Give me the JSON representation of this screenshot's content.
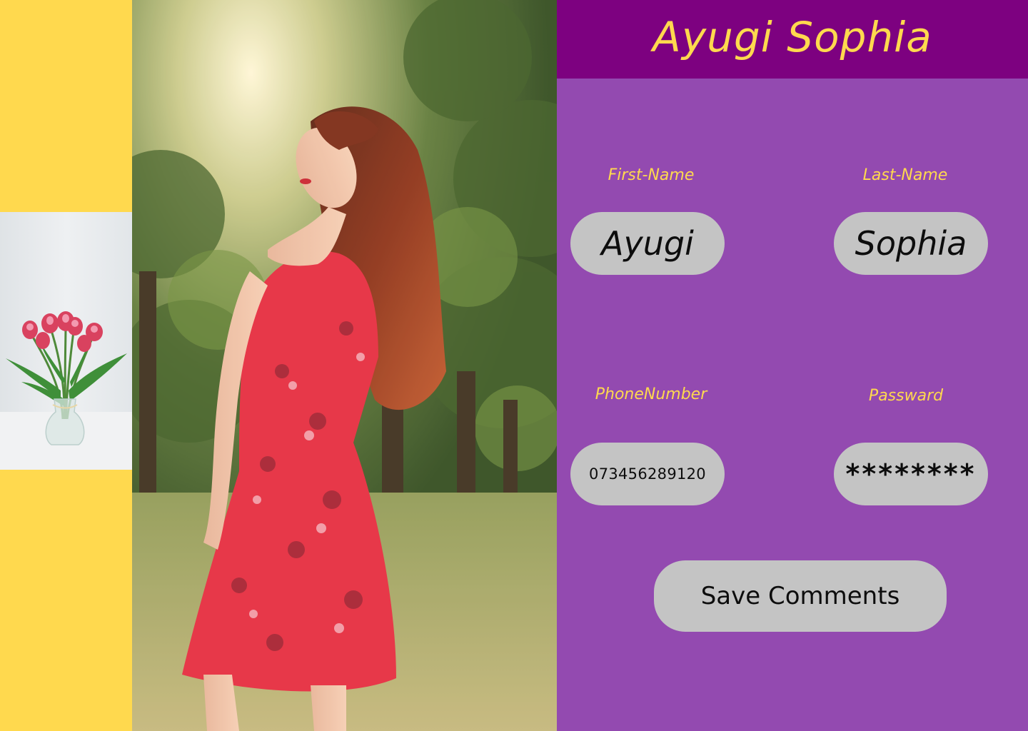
{
  "header": {
    "title": "Ayugi Sophia"
  },
  "form": {
    "first_name": {
      "label": "First-Name",
      "value": "Ayugi"
    },
    "last_name": {
      "label": "Last-Name",
      "value": "Sophia"
    },
    "phone": {
      "label": "PhoneNumber",
      "value": "073456289120"
    },
    "password": {
      "label": "Passward",
      "value": "********"
    },
    "save_label": "Save Comments"
  },
  "colors": {
    "left_strip": "#FFD94E",
    "header_bg": "#7D0180",
    "panel_bg": "#934AB0",
    "accent_text": "#FFD94E",
    "field_bg": "#C4C4C4"
  }
}
